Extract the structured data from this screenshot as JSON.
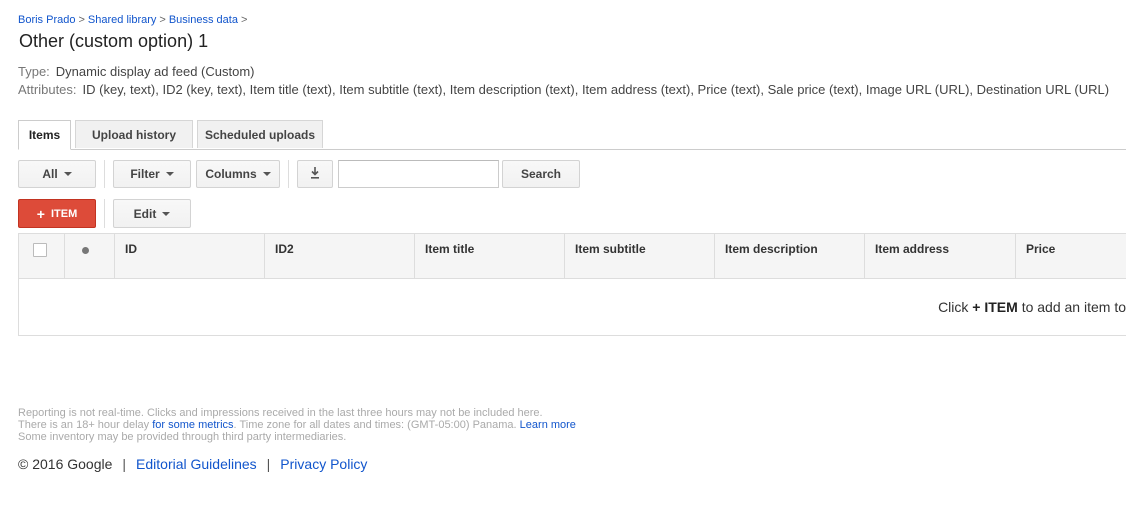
{
  "breadcrumb": [
    "Boris Prado",
    "Shared library",
    "Business data"
  ],
  "breadcrumb_sep": ">",
  "page_title": "Other (custom option) 1",
  "type": {
    "label": "Type:",
    "value": "Dynamic display ad feed (Custom)"
  },
  "attributes": {
    "label": "Attributes:",
    "value": "ID (key, text), ID2 (key, text), Item title (text), Item subtitle (text), Item description (text), Item address (text), Price (text), Sale price (text), Image URL (URL), Destination URL (URL)"
  },
  "tabs": [
    "Items",
    "Upload history",
    "Scheduled uploads"
  ],
  "toolbar": {
    "all": "All",
    "filter": "Filter",
    "columns": "Columns",
    "download_icon": "download-icon",
    "search_value": "",
    "search_button": "Search",
    "item_button_plus": "+",
    "item_button": "ITEM",
    "edit": "Edit"
  },
  "table": {
    "columns": [
      "ID",
      "ID2",
      "Item title",
      "Item subtitle",
      "Item description",
      "Item address",
      "Price"
    ],
    "empty_prefix": "Click",
    "empty_bold": "+ ITEM",
    "empty_suffix": "to add an item to"
  },
  "footnote": {
    "line1": "Reporting is not real-time. Clicks and impressions received in the last three hours may not be included here.",
    "line2_a": "There is an 18+ hour delay",
    "line2_link": "for some metrics",
    "line2_b": ". Time zone for all dates and times: (GMT-05:00) Panama.",
    "line2_link2": "Learn more",
    "line3": "Some inventory may be provided through third party intermediaries."
  },
  "footer": {
    "copyright": "© 2016 Google",
    "sep": "|",
    "link1": "Editorial Guidelines",
    "link2": "Privacy Policy"
  },
  "colors": {
    "accent_red": "#dd4b39",
    "link": "#15c"
  }
}
